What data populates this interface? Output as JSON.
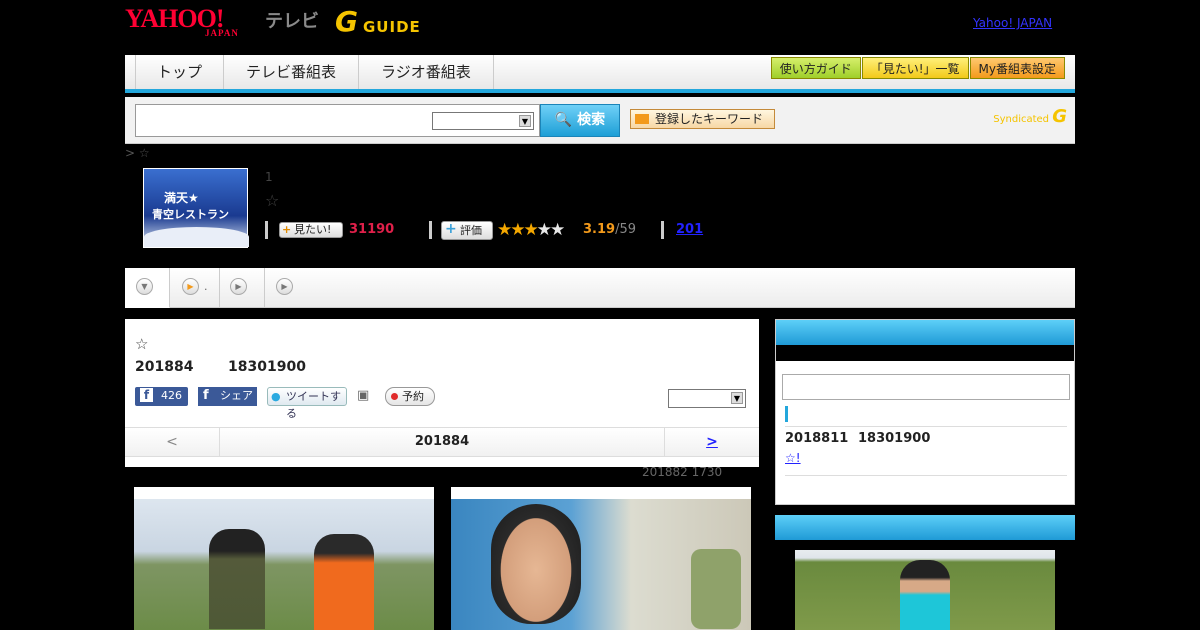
{
  "header": {
    "yahoo_logo": "YAHOO!",
    "yahoo_logo_sub": "JAPAN",
    "tv_label": "テレビ",
    "gguide_logo": "G",
    "gguide_logo_sub": "GUIDE",
    "yahoo_japan_link": "Yahoo! JAPAN"
  },
  "nav": {
    "tabs": [
      "トップ",
      "テレビ番組表",
      "ラジオ番組表"
    ],
    "buttons": [
      "使い方ガイド",
      "「見たい!」一覧",
      "My番組表設定"
    ]
  },
  "search": {
    "button": "検索",
    "keyword_button": "登録したキーワード",
    "syndicated": "Syndicated",
    "syndicated_logo": "G"
  },
  "breadcrumb": "> ☆",
  "program": {
    "thumb_line1": "満天★",
    "thumb_line2": "青空レストラン",
    "number": "1",
    "star": "☆",
    "mitai_label": "見たい!",
    "mitai_count": "31190",
    "hyoka_label": "評価",
    "rating_stars": "★★★",
    "rating_empty": "★★",
    "rating_score": "3.19",
    "rating_count": "/59",
    "reviews_link": "201"
  },
  "subtabs": {
    "tab2_label": "."
  },
  "main": {
    "star": "☆",
    "date": "201884",
    "time": "18301900",
    "fb_like_count": "426",
    "fb_share": "シェア",
    "tweet": "ツイートする",
    "reserve": "予約",
    "pager_prev": "<",
    "pager_current": "201884",
    "pager_next": ">",
    "updated": "201882  1730"
  },
  "sidebar": {
    "date": "2018811",
    "time": "18301900",
    "link": "☆!"
  },
  "colors": {
    "accent": "#23a7dc",
    "mitai_count": "#e0204a",
    "rating": "#f39a1b"
  }
}
